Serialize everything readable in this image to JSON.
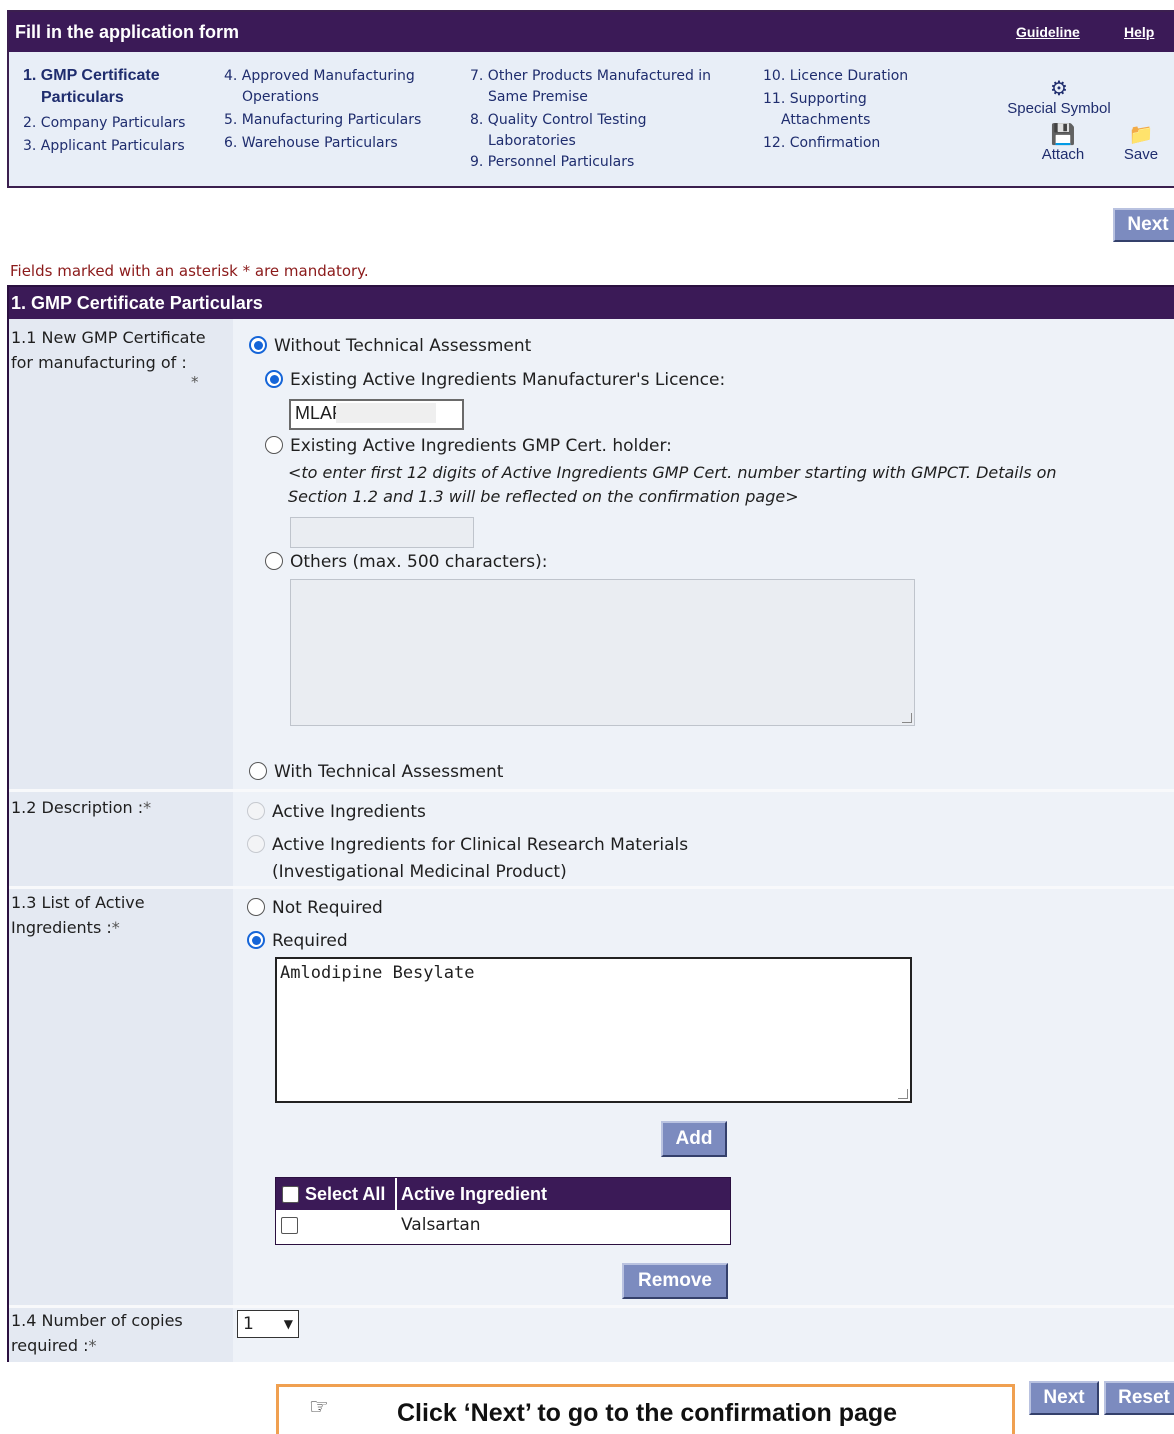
{
  "header": {
    "title": "Fill in the application form",
    "guideline_link": "Guideline",
    "help_link": "Help"
  },
  "steps": [
    {
      "label": "1. GMP Certificate",
      "label2": "Particulars",
      "current": true
    },
    {
      "label": "2. Company Particulars"
    },
    {
      "label": "3. Applicant Particulars"
    },
    {
      "label": "4. Approved Manufacturing",
      "label2": "Operations"
    },
    {
      "label": "5. Manufacturing Particulars"
    },
    {
      "label": "6. Warehouse Particulars"
    },
    {
      "label": "7. Other Products Manufactured in",
      "label2": "Same Premise"
    },
    {
      "label": "8. Quality Control Testing",
      "label2": "Laboratories"
    },
    {
      "label": "9. Personnel Particulars"
    },
    {
      "label": "10. Licence Duration"
    },
    {
      "label": "11. Supporting",
      "label2": "Attachments"
    },
    {
      "label": "12. Confirmation"
    }
  ],
  "tools": {
    "special_symbol": "Special Symbol",
    "attach": "Attach",
    "save": "Save"
  },
  "buttons": {
    "next_top": "Next",
    "add": "Add",
    "remove": "Remove",
    "next_bottom": "Next",
    "reset": "Reset"
  },
  "mandatory_note": "Fields marked with an asterisk * are mandatory.",
  "section": {
    "title": "1. GMP Certificate Particulars"
  },
  "q1_1": {
    "label": "1.1 New GMP Certificate for manufacturing of :",
    "star": "*",
    "without_ta": "Without Technical Assessment",
    "existing_licence": "Existing Active Ingredients Manufacturer's Licence:",
    "licence_value": "MLAP",
    "existing_gmp": "Existing Active Ingredients GMP Cert. holder:",
    "gmp_note_1": "<to enter first 12 digits of Active Ingredients GMP Cert. number starting with GMPCT. Details on",
    "gmp_note_2": "Section 1.2 and 1.3 will be reflected on the confirmation page>",
    "others": "Others (max. 500 characters):",
    "with_ta": "With Technical Assessment"
  },
  "q1_2": {
    "label": "1.2 Description :",
    "star": "*",
    "opt1": "Active Ingredients",
    "opt2": "Active Ingredients for Clinical Research Materials",
    "opt2b": "(Investigational Medicinal Product)"
  },
  "q1_3": {
    "label": "1.3 List of Active Ingredients :",
    "star": "*",
    "not_required": "Not Required",
    "required": "Required",
    "input_value": "Amlodipine Besylate",
    "table": {
      "col_select_all": "Select All",
      "col_ingredient": "Active Ingredient",
      "rows": [
        "Valsartan"
      ]
    }
  },
  "q1_4": {
    "label": "1.4 Number of copies required :",
    "star": "*",
    "value": "1"
  },
  "hint": {
    "text": "Click ‘Next’ to go to the confirmation page"
  },
  "colors": {
    "header_bg": "#3b1a57",
    "button_bg": "#7c8bbf",
    "radio_accent": "#1565d8",
    "hint_border": "#f0a050",
    "mandatory_text": "#8b1a1a"
  }
}
